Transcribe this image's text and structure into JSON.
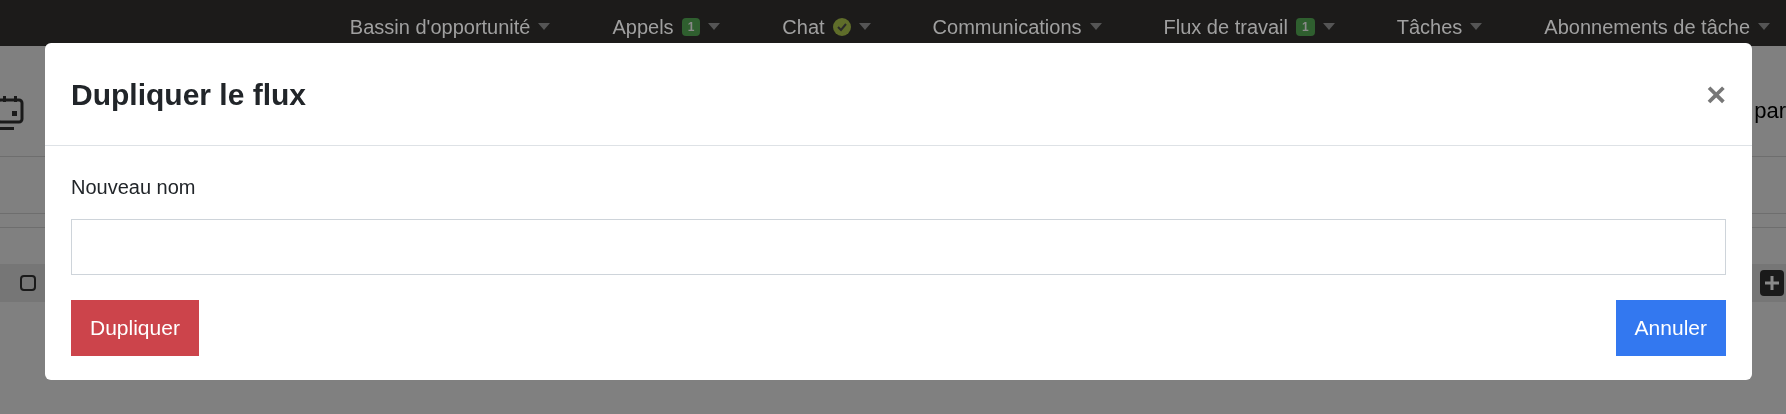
{
  "nav": {
    "items": [
      {
        "label": "Bassin d'opportunité",
        "kind": "plain"
      },
      {
        "label": "Appels",
        "kind": "badge",
        "badge": "1"
      },
      {
        "label": "Chat",
        "kind": "check"
      },
      {
        "label": "Communications",
        "kind": "plain"
      },
      {
        "label": "Flux de travail",
        "kind": "badge",
        "badge": "1"
      },
      {
        "label": "Tâches",
        "kind": "plain"
      },
      {
        "label": "Abonnements de tâche",
        "kind": "plain"
      }
    ]
  },
  "page": {
    "side_text": "par",
    "row": {
      "checked": false
    }
  },
  "dialog": {
    "title": "Dupliquer le flux",
    "close": "×",
    "field": {
      "label": "Nouveau nom"
    },
    "buttons": [
      {
        "label": "Dupliquer",
        "kind": "danger"
      },
      {
        "label": "Annuler",
        "kind": "primary"
      }
    ]
  }
}
